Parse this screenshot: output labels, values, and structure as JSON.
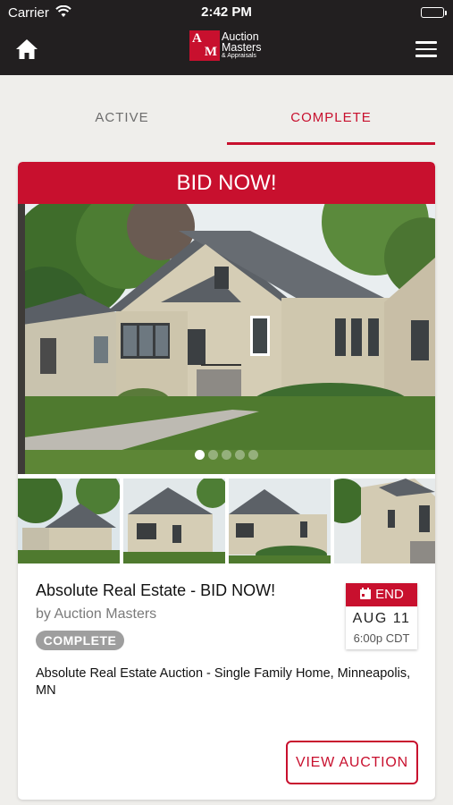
{
  "status_bar": {
    "carrier": "Carrier",
    "time": "2:42 PM"
  },
  "header": {
    "logo_line1": "Auction",
    "logo_line2": "Masters",
    "logo_line3": "& Appraisals",
    "logo_mark_a": "A",
    "logo_mark_m": "M",
    "icons": {
      "home": "home-icon",
      "menu": "hamburger-menu-icon"
    }
  },
  "tabs": [
    {
      "label": "ACTIVE",
      "selected": false
    },
    {
      "label": "COMPLETE",
      "selected": true
    }
  ],
  "listing": {
    "banner": "BID NOW!",
    "carousel": {
      "page_count": 5,
      "current_page": 1
    },
    "title": "Absolute Real Estate - BID NOW!",
    "by": "by Auction Masters",
    "status": "COMPLETE",
    "end": {
      "label": "END",
      "date": "AUG 11",
      "time": "6:00p CDT"
    },
    "description": "Absolute Real Estate Auction - Single Family Home, Minneapolis, MN",
    "cta": "VIEW AUCTION"
  },
  "colors": {
    "brand_red": "#c8102e",
    "header_dark": "#221f20",
    "badge_gray": "#9e9e9e"
  }
}
